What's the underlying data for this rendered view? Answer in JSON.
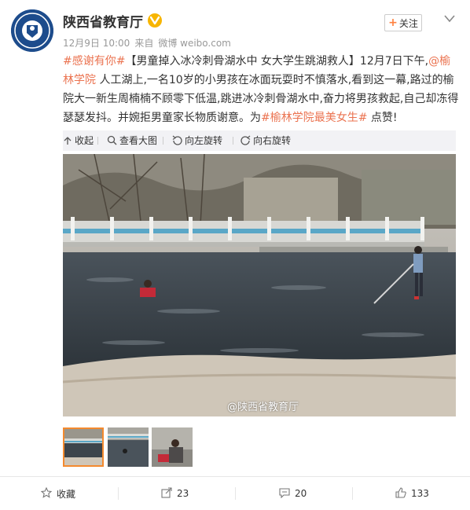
{
  "account": {
    "name": "陕西省教育厅",
    "follow_label": "关注"
  },
  "meta": {
    "date": "12月9日 10:00",
    "source_prefix": "来自",
    "source": "微博 weibo.com"
  },
  "post": {
    "topic1": "#感谢有你#",
    "headline": "【男童掉入冰冷刺骨湖水中  女大学生跳湖救人】12月7日下午,",
    "mention": "@榆林学院",
    "body1": " 人工湖上,一名10岁的小男孩在冰面玩耍时不慎落水,看到这一幕,路过的榆院大一新生周楠楠不顾零下低温,跳进冰冷刺骨湖水中,奋力将男孩救起,自己却冻得瑟瑟发抖。并婉拒男童家长物质谢意。为",
    "topic2": "#榆林学院最美女生#",
    "body2": " 点赞!"
  },
  "toolbar": {
    "collapse": "收起",
    "view_large": "查看大图",
    "rotate_left": "向左旋转",
    "rotate_right": "向右旋转"
  },
  "photo": {
    "watermark": "@陕西省教育厅"
  },
  "actions": {
    "favorite": "收藏",
    "reposts": "23",
    "comments": "20",
    "likes": "133"
  },
  "colors": {
    "link": "#eb7350",
    "badge": "#f7b500",
    "thumb_selected": "#f48a2e"
  }
}
